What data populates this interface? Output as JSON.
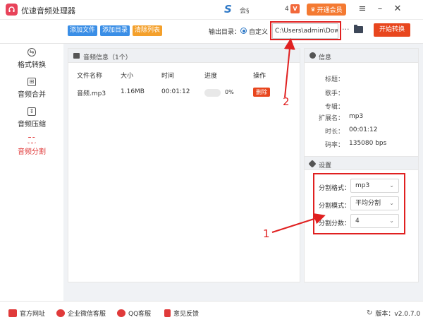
{
  "titlebar": {
    "app_title": "优速音频处理器",
    "user_name": "会§",
    "vip_count": "4",
    "vip_badge": "V",
    "vip_button": "开通会员",
    "menu_icon": "hamburger-icon",
    "minimize_icon": "minimize-icon",
    "close_icon": "close-icon"
  },
  "toolbar": {
    "add_file": "添加文件",
    "add_folder": "添加目录",
    "clear_list": "清除列表",
    "output_dir_label": "输出目录：",
    "custom_label": "自定义",
    "output_path": "C:\\Users\\admin\\Downl",
    "more": "···",
    "start_button": "开始转换",
    "colors": {
      "blue": "#3a8ee6",
      "orange": "#f4a02b",
      "start": "#e8461e"
    }
  },
  "sidebar": {
    "items": [
      {
        "label": "格式转换",
        "icon": "format-convert-icon",
        "active": false
      },
      {
        "label": "音频合并",
        "icon": "audio-merge-icon",
        "active": false
      },
      {
        "label": "音频压缩",
        "icon": "audio-compress-icon",
        "active": false
      },
      {
        "label": "音频分割",
        "icon": "audio-split-icon",
        "active": true
      }
    ]
  },
  "file_list": {
    "header": "音频信息（1个）",
    "columns": [
      "文件名称",
      "大小",
      "时间",
      "进度",
      "操作"
    ],
    "rows": [
      {
        "name": "音频.mp3",
        "size": "1.16MB",
        "time": "00:01:12",
        "progress": "0%",
        "action": "删除"
      }
    ]
  },
  "info": {
    "header": "信息",
    "fields": [
      {
        "label": "标题：",
        "value": ""
      },
      {
        "label": "歌手：",
        "value": ""
      },
      {
        "label": "专辑：",
        "value": ""
      },
      {
        "label": "扩展名：",
        "value": "mp3"
      },
      {
        "label": "时长：",
        "value": "00:01:12"
      },
      {
        "label": "码率：",
        "value": "135080 bps"
      }
    ]
  },
  "settings": {
    "header": "设置",
    "split_format_label": "分割格式：",
    "split_format_value": "mp3",
    "split_mode_label": "分割模式：",
    "split_mode_value": "平均分割",
    "split_count_label": "分割分数：",
    "split_count_value": "4"
  },
  "footer": {
    "website": "官方网址",
    "wechat": "企业微信客服",
    "qq": "QQ客服",
    "feedback": "意见反馈",
    "version": "版本：v2.0.7.0"
  },
  "annotations": {
    "label_1": "1",
    "label_2": "2",
    "color": "#e02020"
  }
}
